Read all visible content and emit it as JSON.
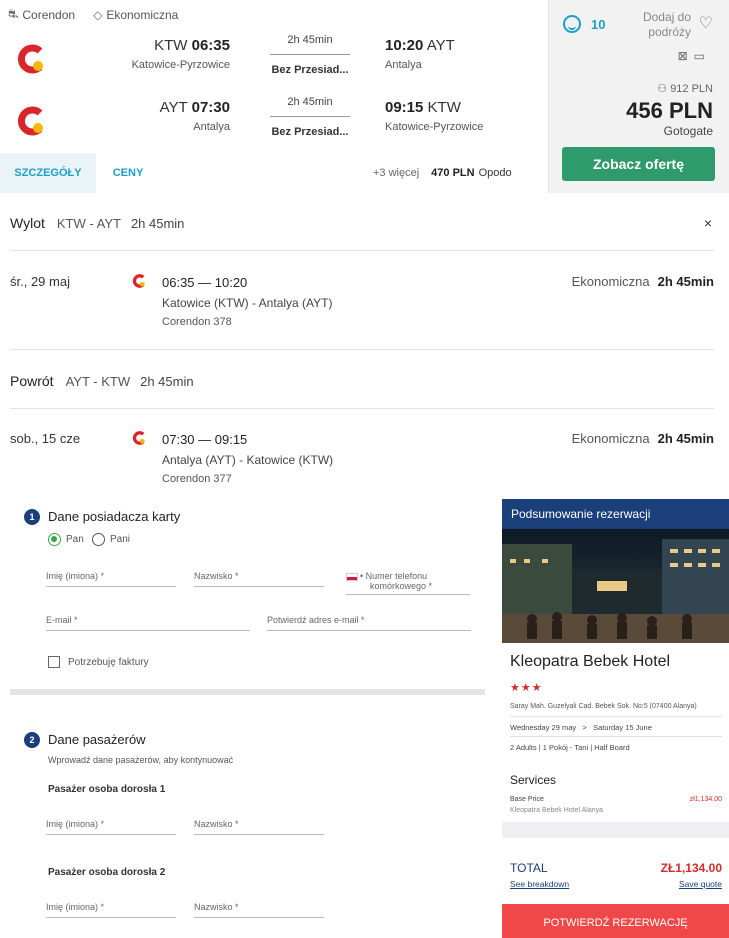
{
  "card": {
    "airline": "Corendon",
    "cabin": "Ekonomiczna",
    "legs": [
      {
        "dep_code": "KTW",
        "dep_time": "06:35",
        "dep_city": "Katowice-Pyrzowice",
        "duration": "2h 45min",
        "stops": "Bez Przesiad...",
        "arr_time": "10:20",
        "arr_code": "AYT",
        "arr_city": "Antalya"
      },
      {
        "dep_code": "AYT",
        "dep_time": "07:30",
        "dep_city": "Antalya",
        "duration": "2h 45min",
        "stops": "Bez Przesiad...",
        "arr_time": "09:15",
        "arr_code": "KTW",
        "arr_city": "Katowice-Pyrzowice"
      }
    ],
    "tabs": [
      "SZCZEGÓŁY",
      "CENY"
    ],
    "more_text": "+3 więcej",
    "more_price": "470 PLN",
    "more_provider": "Opodo",
    "score": "10",
    "fav_line1": "Dodaj do",
    "fav_line2": "podróży",
    "per_person": "912 PLN",
    "price": "456 PLN",
    "seller": "Gotogate",
    "cta": "Zobacz ofertę"
  },
  "details": {
    "outbound_title": "Wylot",
    "outbound_route": "KTW - AYT",
    "outbound_duration": "2h 45min",
    "close": "×",
    "out_date": "śr., 29 maj",
    "out_times": "06:35 — 10:20",
    "out_route": "Katowice (KTW) - Antalya (AYT)",
    "out_flight": "Corendon 378",
    "out_cabin": "Ekonomiczna",
    "out_dur": "2h 45min",
    "return_title": "Powrót",
    "return_route": "AYT - KTW",
    "return_duration": "2h 45min",
    "ret_date": "sob., 15 cze",
    "ret_times": "07:30 — 09:15",
    "ret_route": "Antalya (AYT) - Katowice (KTW)",
    "ret_flight": "Corendon 377",
    "ret_cabin": "Ekonomiczna",
    "ret_dur": "2h 45min"
  },
  "form": {
    "step1_num": "1",
    "step1_title": "Dane posiadacza karty",
    "radio_mr": "Pan",
    "radio_mrs": "Pani",
    "first_name": "Imię (imiona) *",
    "last_name": "Nazwisko *",
    "phone_l1": "• Numer telefonu",
    "phone_l2": "komórkowego *",
    "email": "E-mail *",
    "confirm_email": "Potwierdź adres e-mail *",
    "invoice": "Potrzebuję faktury",
    "step2_num": "2",
    "step2_title": "Dane pasażerów",
    "step2_sub": "Wprowadź dane pasażerów, aby kontynuować",
    "pax1": "Pasażer osoba dorosła 1",
    "pax2": "Pasażer osoba dorosła 2",
    "pax_first": "Imię (imiona) *",
    "pax_last": "Nazwisko *"
  },
  "summary": {
    "header": "Podsumowanie rezerwacji",
    "hotel": "Kleopatra Bebek Hotel",
    "stars": "★★★",
    "address": "Saray Mah. Guzelyali Cad. Bebek Sok. No:5 (07400 Alanya)",
    "checkin": "Wednesday 29 may",
    "arrow": ">",
    "checkout": "Saturday 15 June",
    "room": "2 Adults | 1 Pokój - Tani | Half Board",
    "services": "Services",
    "base_price": "Base Price",
    "base_hotel": "Kleopatra Bebek Hotel Alanya",
    "base_value": "zł1,134.00",
    "total": "TOTAL",
    "total_value": "ZŁ1,134.00",
    "breakdown": "See breakdown",
    "save_quote": "Save quote",
    "confirm": "POTWIERDŹ REZERWACJĘ"
  }
}
